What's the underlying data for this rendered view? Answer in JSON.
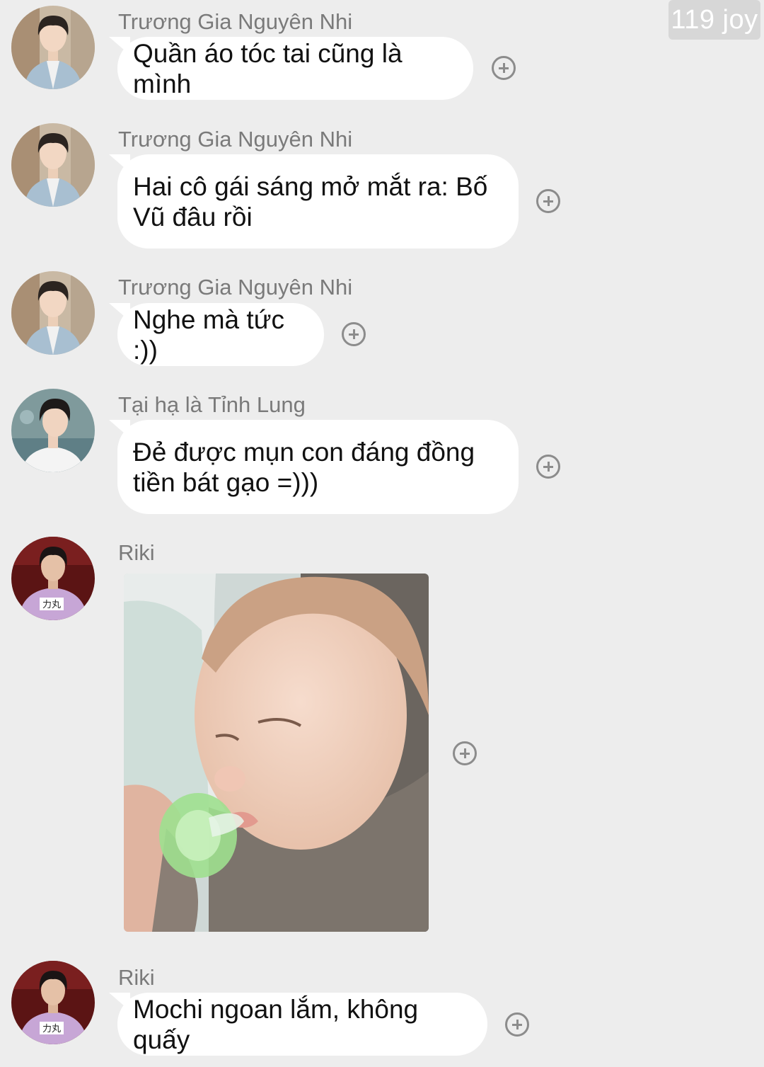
{
  "watermark": "119 joy",
  "messages": [
    {
      "sender": "Trương Gia Nguyên Nhi",
      "text": "Quần áo tóc tai cũng là mình",
      "avatar": "avatar-nguyen-nhi"
    },
    {
      "sender": "Trương Gia Nguyên Nhi",
      "lines": [
        "Hai cô gái sáng mở mắt ra: Bố",
        "Vũ đâu rồi"
      ],
      "avatar": "avatar-nguyen-nhi"
    },
    {
      "sender": "Trương Gia Nguyên Nhi",
      "text": "Nghe mà tức :))",
      "avatar": "avatar-nguyen-nhi"
    },
    {
      "sender": "Tại hạ là Tỉnh Lung",
      "lines": [
        "Đẻ được mụn con đáng đồng",
        "tiền bát gạo =)))"
      ],
      "avatar": "avatar-tinh-lung"
    },
    {
      "sender": "Riki",
      "image": "sleeping-baby-photo",
      "avatar": "avatar-riki"
    },
    {
      "sender": "Riki",
      "text": "Mochi ngoan lắm, không quấy",
      "avatar": "avatar-riki"
    }
  ],
  "icons": {
    "reaction": "plus-circle-icon"
  },
  "colors": {
    "background": "#ededed",
    "bubble": "#ffffff",
    "sender_name": "#7a7a7a",
    "message_text": "#111111",
    "icon": "#8c8c8c"
  }
}
